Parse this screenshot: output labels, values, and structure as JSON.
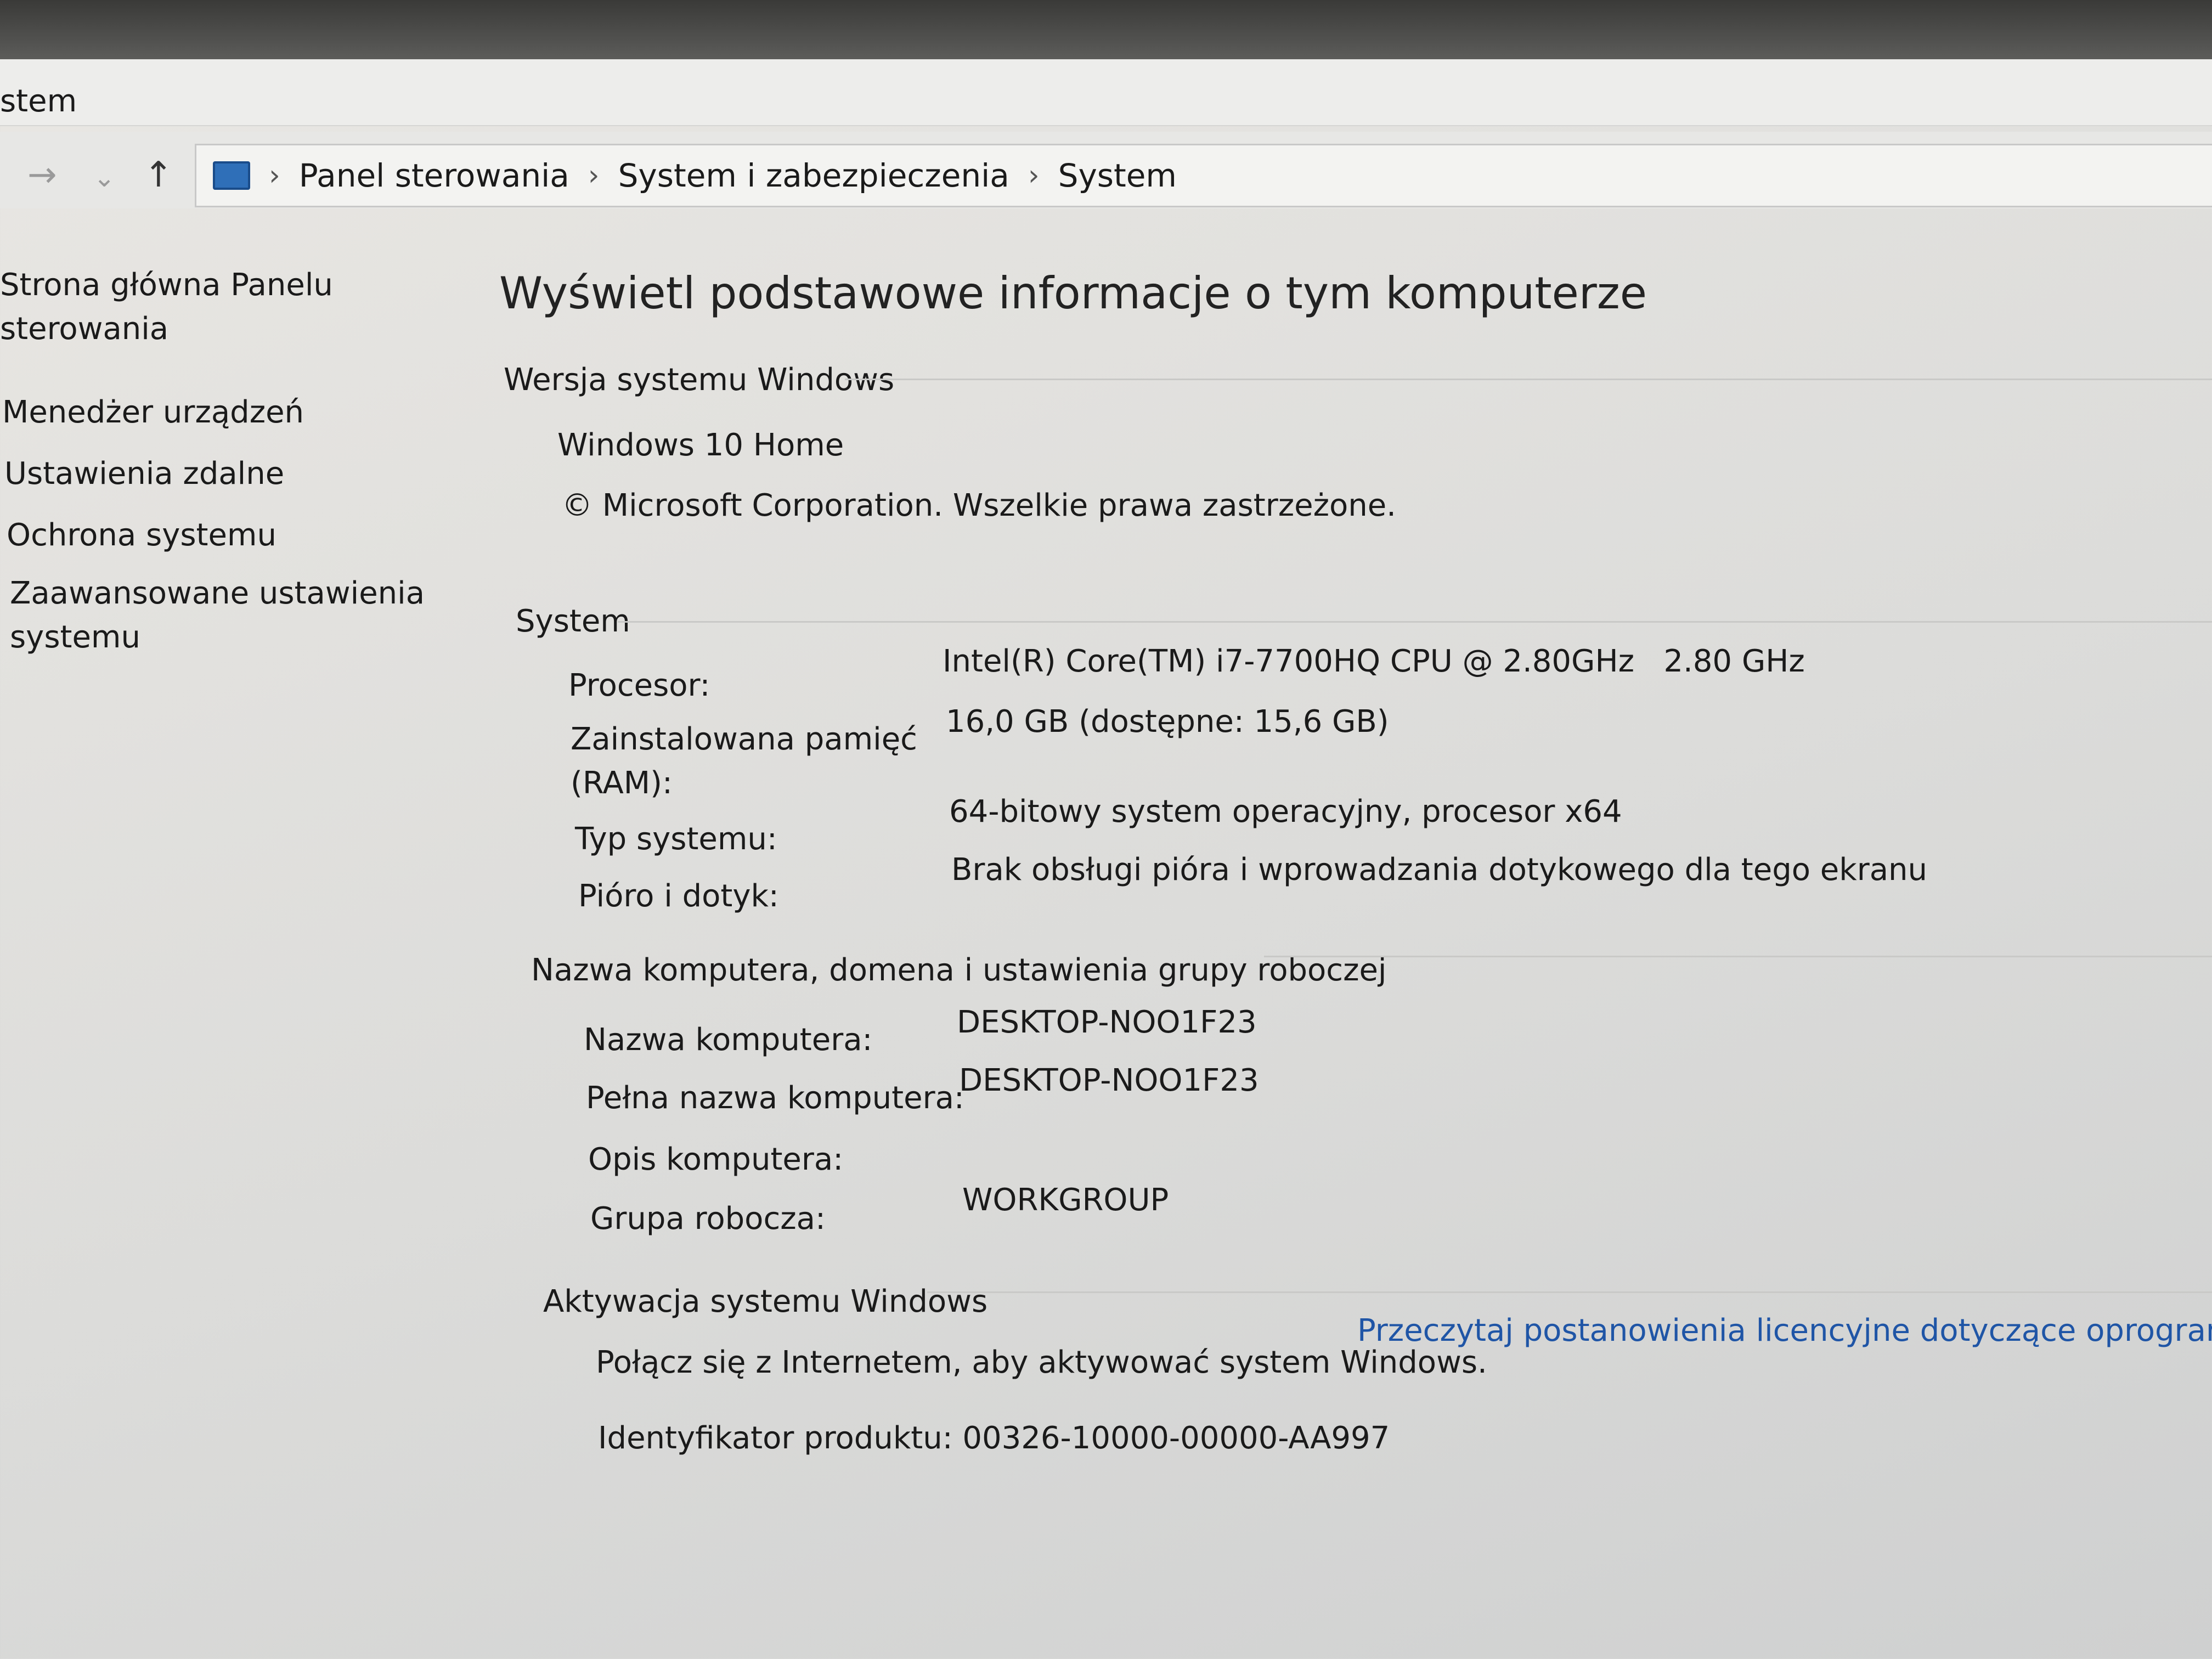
{
  "window": {
    "title": "stem"
  },
  "nav": {
    "back": "←",
    "forward": "→",
    "recent": "⌄",
    "up": "↑"
  },
  "breadcrumb": [
    "Panel sterowania",
    "System i zabezpieczenia",
    "System"
  ],
  "sidebar": {
    "home": [
      "Strona główna Panelu",
      "sterowania"
    ],
    "items": [
      "Menedżer urządzeń",
      "Ustawienia zdalne",
      "Ochrona systemu"
    ],
    "advanced": [
      "Zaawansowane ustawienia",
      "systemu"
    ]
  },
  "main": {
    "heading": "Wyświetl podstawowe informacje o tym komputerze",
    "windows_edition": {
      "title": "Wersja systemu Windows",
      "edition": "Windows 10 Home",
      "copyright": "© Microsoft Corporation. Wszelkie prawa zastrzeżone."
    },
    "system": {
      "title": "System",
      "processor_label": "Procesor:",
      "processor_value": "Intel(R) Core(TM) i7-7700HQ CPU @ 2.80GHz   2.80 GHz",
      "ram_label": [
        "Zainstalowana pamięć",
        "(RAM):"
      ],
      "ram_value": "16,0 GB (dostępne: 15,6 GB)",
      "type_label": "Typ systemu:",
      "type_value": "64-bitowy system operacyjny, procesor x64",
      "pen_label": "Pióro i dotyk:",
      "pen_value": "Brak obsługi pióra i wprowadzania dotykowego dla tego ekranu"
    },
    "computer_name": {
      "title": "Nazwa komputera, domena i ustawienia grupy roboczej",
      "name_label": "Nazwa komputera:",
      "name_value": "DESKTOP-NOO1F23",
      "full_label": "Pełna nazwa komputera:",
      "full_value": "DESKTOP-NOO1F23",
      "desc_label": "Opis komputera:",
      "desc_value": "",
      "workgroup_label": "Grupa robocza:",
      "workgroup_value": "WORKGROUP"
    },
    "activation": {
      "title": "Aktywacja systemu Windows",
      "status": "Połącz się z Internetem, aby aktywować system Windows.",
      "license_link": "Przeczytaj postanowienia licencyjne dotyczące oprogramowania firm",
      "product_id": "Identyfikator produktu: 00326-10000-00000-AA997"
    }
  }
}
